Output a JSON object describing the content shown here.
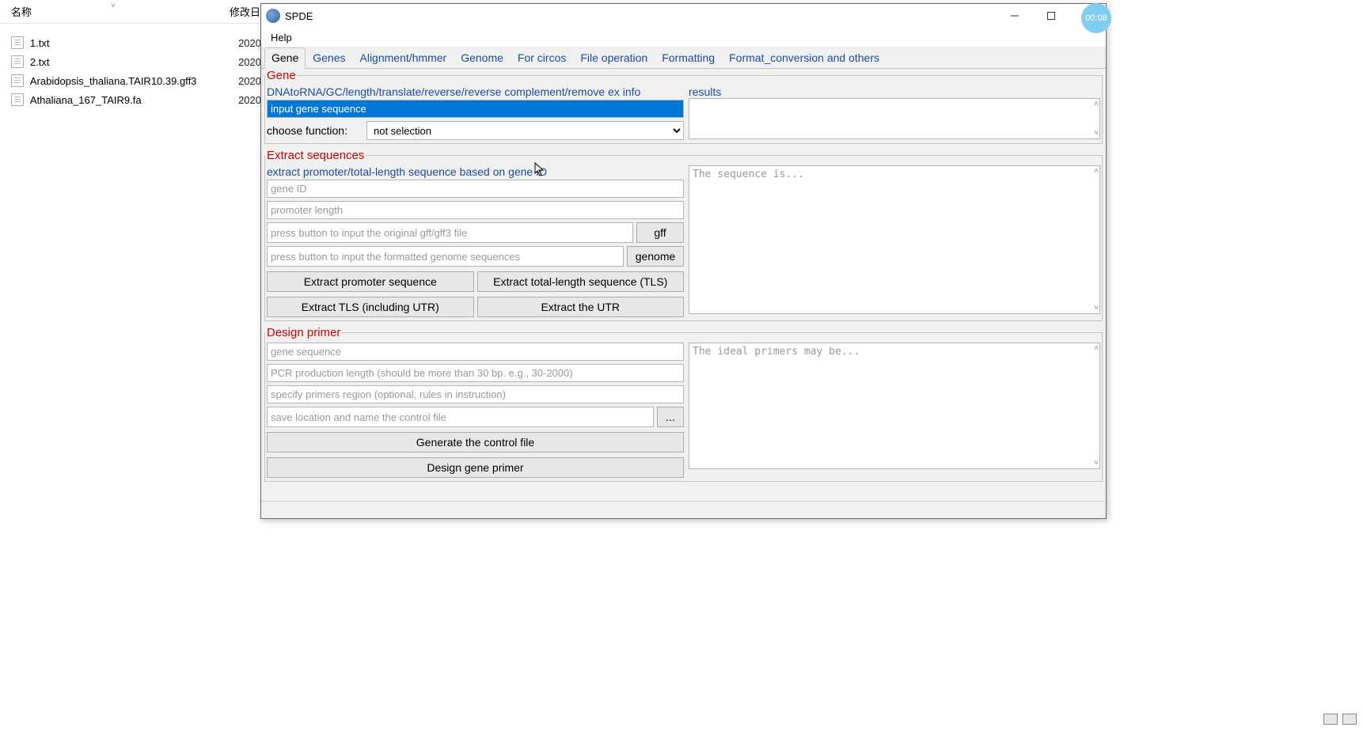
{
  "explorer": {
    "col_name": "名称",
    "col_date": "修改日",
    "files": [
      {
        "name": "1.txt",
        "date": "2020"
      },
      {
        "name": "2.txt",
        "date": "2020"
      },
      {
        "name": "Arabidopsis_thaliana.TAIR10.39.gff3",
        "date": "2020"
      },
      {
        "name": "Athaliana_167_TAIR9.fa",
        "date": "2020"
      }
    ]
  },
  "window": {
    "title": "SPDE",
    "menubar": {
      "help": "Help"
    },
    "tabs": [
      "Gene",
      "Genes",
      "Alignment/hmmer",
      "Genome",
      "For circos",
      "File operation",
      "Formatting",
      "Format_conversion and others"
    ],
    "active_tab_index": 0
  },
  "gene_group": {
    "legend": "Gene",
    "desc": "DNAtoRNA/GC/length/translate/reverse/reverse complement/remove ex info",
    "results_label": "results",
    "input_placeholder": "input gene sequence",
    "choose_label": "choose function:",
    "choose_value": "not selection"
  },
  "extract_group": {
    "legend": "Extract sequences",
    "desc": "extract promoter/total-length sequence based on gene ID",
    "result_placeholder": "The sequence is...",
    "gene_id_placeholder": "gene ID",
    "promoter_len_placeholder": "promoter length",
    "gff_path_placeholder": "press button to input the original gff/gff3 file",
    "gff_btn": "gff",
    "genome_path_placeholder": "press button to input the formatted genome sequences",
    "genome_btn": "genome",
    "btns": {
      "ex_promoter": "Extract promoter sequence",
      "ex_tls": "Extract total-length sequence (TLS)",
      "ex_tls_utr": "Extract TLS (including UTR)",
      "ex_utr": "Extract the UTR"
    }
  },
  "primer_group": {
    "legend": "Design primer",
    "result_placeholder": "The ideal primers may be...",
    "gene_seq_placeholder": "gene sequence",
    "pcr_len_placeholder": "PCR production length (should be more than 30 bp. e.g., 30-2000)",
    "region_placeholder": "specify primers region (optional, rules in instruction)",
    "save_placeholder": "save location and name the control file",
    "browse_btn": "...",
    "gen_btn": "Generate the control file",
    "design_btn": "Design gene primer"
  },
  "timer": "00:08"
}
